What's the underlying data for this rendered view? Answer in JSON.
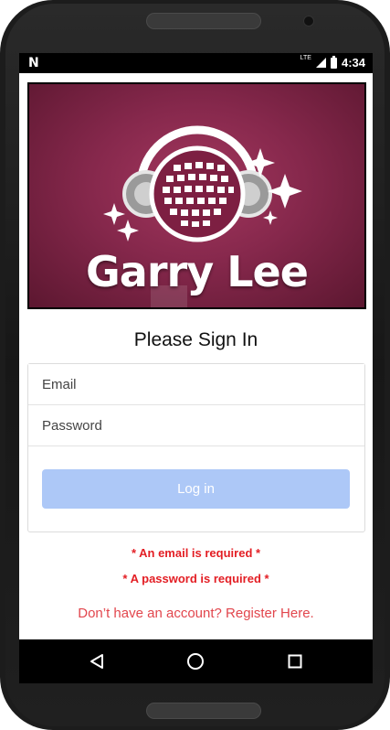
{
  "status_bar": {
    "left_icon": "N",
    "network_label": "LTE",
    "time": "4:34"
  },
  "banner": {
    "logo_text": "Garry Lee"
  },
  "heading": "Please Sign In",
  "form": {
    "email_placeholder": "Email",
    "password_placeholder": "Password",
    "login_label": "Log in"
  },
  "errors": {
    "email": "* An email is required *",
    "password": "* A password is required *"
  },
  "register_link": "Don’t have an account? Register Here.",
  "nav": {
    "back_icon": "back-triangle-icon",
    "home_icon": "home-circle-icon",
    "recents_icon": "recents-square-icon"
  },
  "colors": {
    "banner_bg": "#86284c",
    "login_button": "#adc8f7",
    "error_text": "#e31e24",
    "link_text": "#e2464d"
  }
}
